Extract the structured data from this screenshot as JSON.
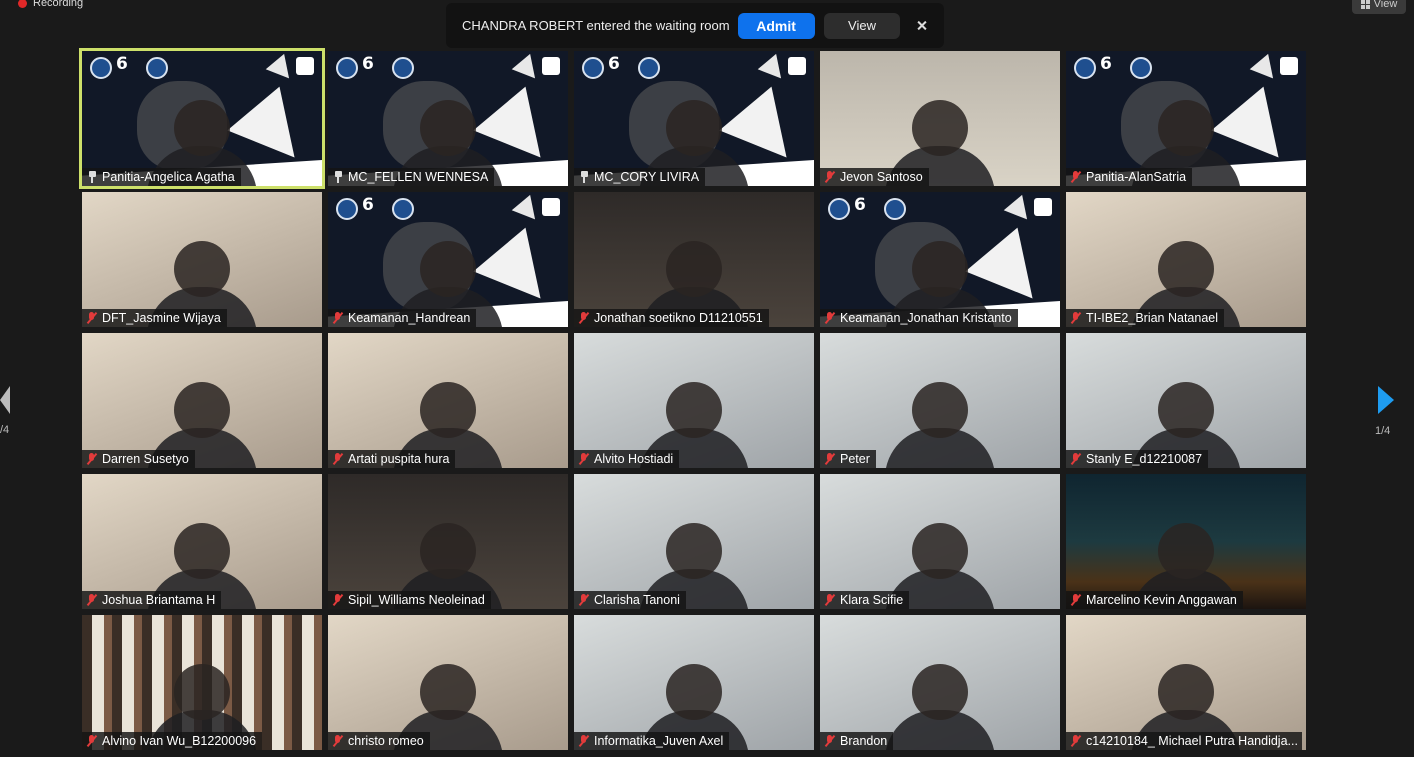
{
  "recording": {
    "label": "Recording"
  },
  "top_right": {
    "view_label": "View",
    "icon": "grid-view-icon"
  },
  "notification": {
    "message": "CHANDRA ROBERT entered the waiting room",
    "admit_label": "Admit",
    "view_label": "View",
    "close_icon": "close-icon"
  },
  "pager": {
    "left_page": "/4",
    "right_page": "1/4"
  },
  "participants": [
    {
      "name": "Panitia-Angelica Agatha",
      "status": "pinned",
      "active": true,
      "bg": "vb"
    },
    {
      "name": "MC_FELLEN WENNESA",
      "status": "pinned",
      "bg": "vb"
    },
    {
      "name": "MC_CORY LIVIRA",
      "status": "pinned",
      "bg": "vb"
    },
    {
      "name": "Jevon Santoso",
      "status": "muted",
      "bg": "wall"
    },
    {
      "name": "Panitia-AlanSatria",
      "status": "muted",
      "bg": "vb"
    },
    {
      "name": "DFT_Jasmine Wijaya",
      "status": "muted",
      "bg": "warm"
    },
    {
      "name": "Keamanan_Handrean",
      "status": "muted",
      "bg": "vb"
    },
    {
      "name": "Jonathan soetikno D11210551",
      "status": "muted",
      "bg": "dark"
    },
    {
      "name": "Keamanan_Jonathan Kristanto",
      "status": "muted",
      "bg": "vb"
    },
    {
      "name": "TI-IBE2_Brian Natanael",
      "status": "muted",
      "bg": "warm"
    },
    {
      "name": "Darren Susetyo",
      "status": "muted",
      "bg": "warm"
    },
    {
      "name": "Artati puspita hura",
      "status": "muted",
      "bg": "warm"
    },
    {
      "name": "Alvito Hostiadi",
      "status": "muted",
      "bg": "cool"
    },
    {
      "name": "Peter",
      "status": "muted",
      "bg": "cool"
    },
    {
      "name": "Stanly E_d12210087",
      "status": "muted",
      "bg": "cool"
    },
    {
      "name": "Joshua Briantama H",
      "status": "muted",
      "bg": "warm"
    },
    {
      "name": "Sipil_Williams Neoleinad",
      "status": "muted",
      "bg": "dark"
    },
    {
      "name": "Clarisha Tanoni",
      "status": "muted",
      "bg": "cool"
    },
    {
      "name": "Klara Scifie",
      "status": "muted",
      "bg": "cool"
    },
    {
      "name": "Marcelino Kevin Anggawan",
      "status": "muted",
      "bg": "night"
    },
    {
      "name": "Alvino Ivan Wu_B12200096",
      "status": "muted",
      "bg": "stripes"
    },
    {
      "name": "christo romeo",
      "status": "muted",
      "bg": "warm"
    },
    {
      "name": "Informatika_Juven Axel",
      "status": "muted",
      "bg": "cool"
    },
    {
      "name": "Brandon",
      "status": "muted",
      "bg": "cool"
    },
    {
      "name": "c14210184_ Michael Putra Handidja...",
      "status": "muted",
      "bg": "warm"
    }
  ]
}
